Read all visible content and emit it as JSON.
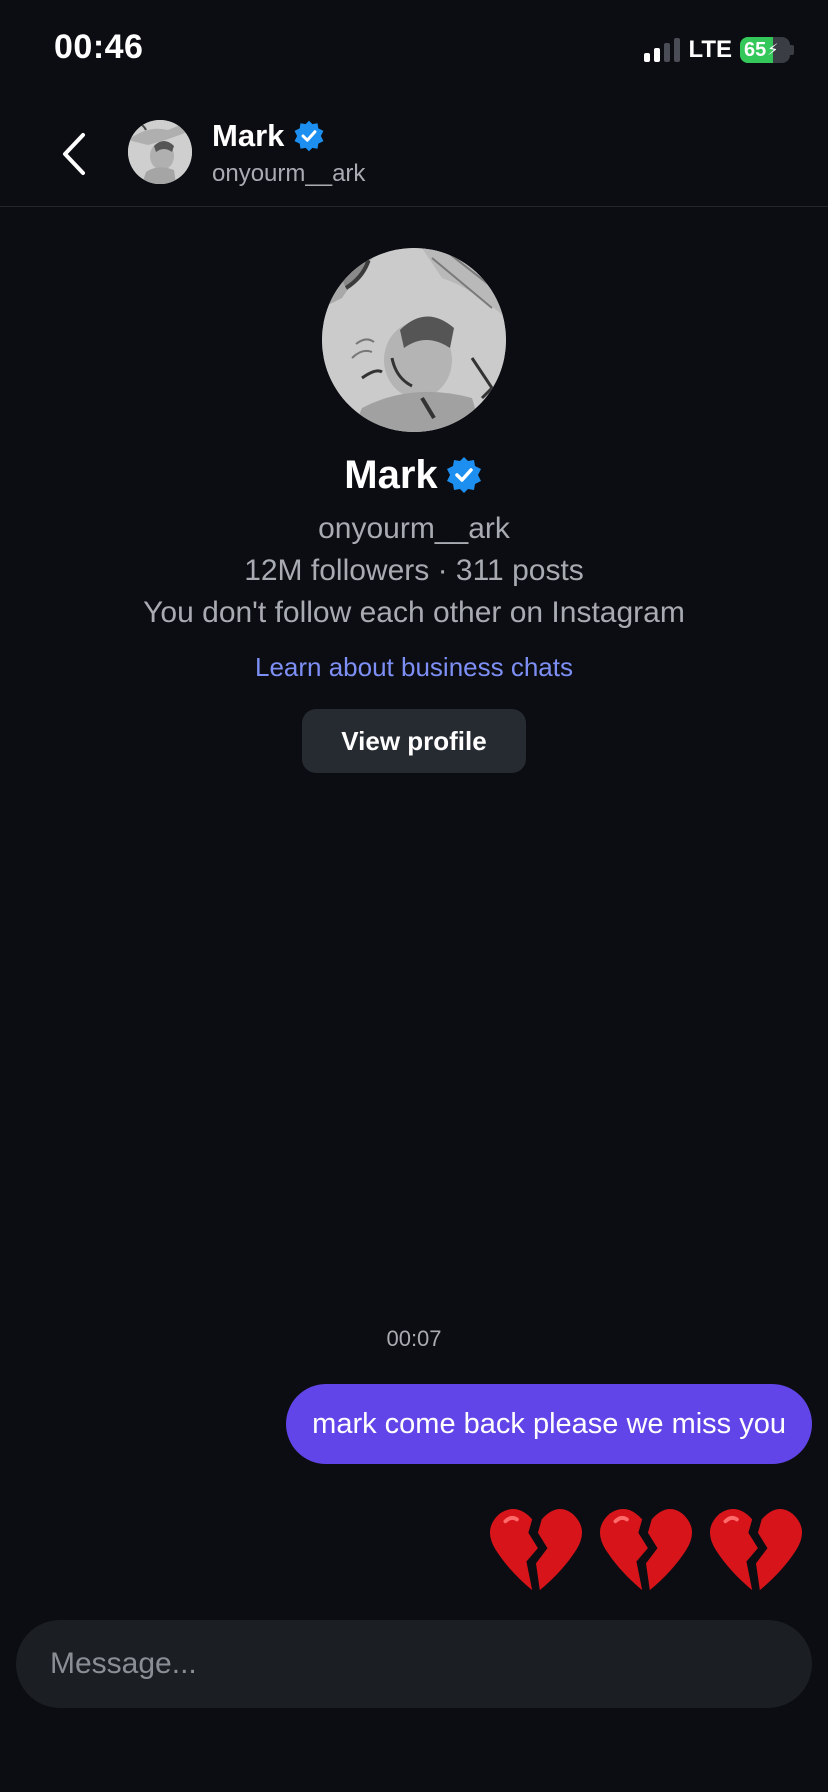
{
  "status_bar": {
    "time": "00:46",
    "network": "LTE",
    "battery_percent": "65",
    "battery_level": 0.65,
    "signal_bars_active": 2,
    "signal_bars_total": 4
  },
  "header": {
    "name": "Mark",
    "username": "onyourm__ark",
    "verified": true
  },
  "profile": {
    "name": "Mark",
    "username": "onyourm__ark",
    "stats": "12M followers · 311 posts",
    "follow_note": "You don't follow each other on Instagram",
    "business_link": "Learn about business chats",
    "view_profile_label": "View profile"
  },
  "messages": {
    "timestamp": "00:07",
    "items": [
      {
        "text": "mark come back please we miss you"
      }
    ],
    "emoji_count": 3
  },
  "composer": {
    "placeholder": "Message..."
  },
  "colors": {
    "background": "#0b0d12",
    "bubble": "#6245e8",
    "link": "#7d8ff5",
    "verified": "#1d8ff0",
    "battery": "#34c759"
  }
}
